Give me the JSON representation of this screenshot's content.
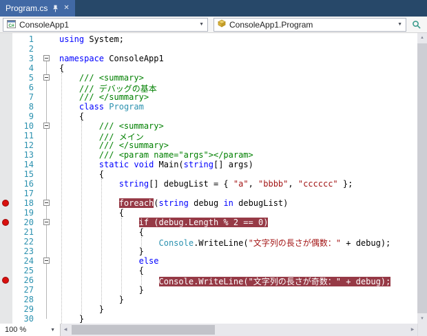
{
  "tab": {
    "title": "Program.cs"
  },
  "icons": {
    "close": "✕",
    "chevron_down": "▼",
    "scroll_up": "▲",
    "scroll_down": "▼",
    "scroll_left": "◀",
    "scroll_right": "▶"
  },
  "navbar": {
    "project": "ConsoleApp1",
    "member": "ConsoleApp1.Program"
  },
  "statusbar": {
    "zoom_level": "100 %"
  },
  "colors": {
    "keyword": "#0000ff",
    "comment": "#008000",
    "string": "#a31515",
    "type": "#2b91af",
    "line_number": "#2b91af",
    "breakpoint_highlight_bg": "#963a46",
    "breakpoint_dot": "#d8100e",
    "tab_active_bg": "#4169a5",
    "tab_strip_bg": "#274869"
  },
  "code": {
    "lines": [
      {
        "n": 1,
        "seg": [
          [
            "kw",
            "using"
          ],
          [
            "pl",
            " System;"
          ]
        ]
      },
      {
        "n": 2,
        "seg": []
      },
      {
        "n": 3,
        "fold": true,
        "seg": [
          [
            "kw",
            "namespace"
          ],
          [
            "pl",
            " ConsoleApp1"
          ]
        ]
      },
      {
        "n": 4,
        "seg": [
          [
            "pl",
            "{"
          ]
        ]
      },
      {
        "n": 5,
        "fold": true,
        "seg": [
          [
            "cm",
            "    /// <summary>"
          ]
        ]
      },
      {
        "n": 6,
        "seg": [
          [
            "cm",
            "    /// デバッグの基本"
          ]
        ]
      },
      {
        "n": 7,
        "seg": [
          [
            "cm",
            "    /// </summary>"
          ]
        ]
      },
      {
        "n": 8,
        "seg": [
          [
            "pl",
            "    "
          ],
          [
            "kw",
            "class"
          ],
          [
            "pl",
            " "
          ],
          [
            "ty",
            "Program"
          ]
        ]
      },
      {
        "n": 9,
        "seg": [
          [
            "pl",
            "    {"
          ]
        ]
      },
      {
        "n": 10,
        "fold": true,
        "seg": [
          [
            "cm",
            "        /// <summary>"
          ]
        ]
      },
      {
        "n": 11,
        "seg": [
          [
            "cm",
            "        /// メイン"
          ]
        ]
      },
      {
        "n": 12,
        "seg": [
          [
            "cm",
            "        /// </summary>"
          ]
        ]
      },
      {
        "n": 13,
        "seg": [
          [
            "cm",
            "        /// <param name=\"args\"></param>"
          ]
        ]
      },
      {
        "n": 14,
        "seg": [
          [
            "pl",
            "        "
          ],
          [
            "kw",
            "static"
          ],
          [
            "pl",
            " "
          ],
          [
            "kw",
            "void"
          ],
          [
            "pl",
            " Main("
          ],
          [
            "kw",
            "string"
          ],
          [
            "pl",
            "[] args)"
          ]
        ]
      },
      {
        "n": 15,
        "seg": [
          [
            "pl",
            "        {"
          ]
        ]
      },
      {
        "n": 16,
        "seg": [
          [
            "pl",
            "            "
          ],
          [
            "kw",
            "string"
          ],
          [
            "pl",
            "[] debugList = { "
          ],
          [
            "str",
            "\"a\""
          ],
          [
            "pl",
            ", "
          ],
          [
            "str",
            "\"bbbb\""
          ],
          [
            "pl",
            ", "
          ],
          [
            "str",
            "\"cccccc\""
          ],
          [
            "pl",
            " };"
          ]
        ]
      },
      {
        "n": 17,
        "seg": []
      },
      {
        "n": 18,
        "bp": true,
        "fold": true,
        "seg": [
          [
            "pl",
            "            "
          ],
          [
            "hl",
            "foreach"
          ],
          [
            "pl",
            "("
          ],
          [
            "kw",
            "string"
          ],
          [
            "pl",
            " debug "
          ],
          [
            "kw",
            "in"
          ],
          [
            "pl",
            " debugList)"
          ]
        ]
      },
      {
        "n": 19,
        "seg": [
          [
            "pl",
            "            {"
          ]
        ]
      },
      {
        "n": 20,
        "bp": true,
        "fold": true,
        "seg": [
          [
            "pl",
            "                "
          ],
          [
            "hl",
            "if (debug.Length % 2 == 0)"
          ]
        ]
      },
      {
        "n": 21,
        "seg": [
          [
            "pl",
            "                {"
          ]
        ]
      },
      {
        "n": 22,
        "seg": [
          [
            "pl",
            "                    "
          ],
          [
            "ty",
            "Console"
          ],
          [
            "pl",
            ".WriteLine("
          ],
          [
            "str",
            "\"文字列の長さが偶数：\""
          ],
          [
            "pl",
            " + debug);"
          ]
        ]
      },
      {
        "n": 23,
        "seg": [
          [
            "pl",
            "                }"
          ]
        ]
      },
      {
        "n": 24,
        "fold": true,
        "seg": [
          [
            "pl",
            "                "
          ],
          [
            "kw",
            "else"
          ]
        ]
      },
      {
        "n": 25,
        "seg": [
          [
            "pl",
            "                {"
          ]
        ]
      },
      {
        "n": 26,
        "bp": true,
        "seg": [
          [
            "pl",
            "                    "
          ],
          [
            "hl",
            "Console.WriteLine(\"文字列の長さが奇数：\" + debug);"
          ]
        ]
      },
      {
        "n": 27,
        "seg": [
          [
            "pl",
            "                }"
          ]
        ]
      },
      {
        "n": 28,
        "seg": [
          [
            "pl",
            "            }"
          ]
        ]
      },
      {
        "n": 29,
        "seg": [
          [
            "pl",
            "        }"
          ]
        ]
      },
      {
        "n": 30,
        "seg": [
          [
            "pl",
            "    }"
          ]
        ]
      }
    ]
  }
}
